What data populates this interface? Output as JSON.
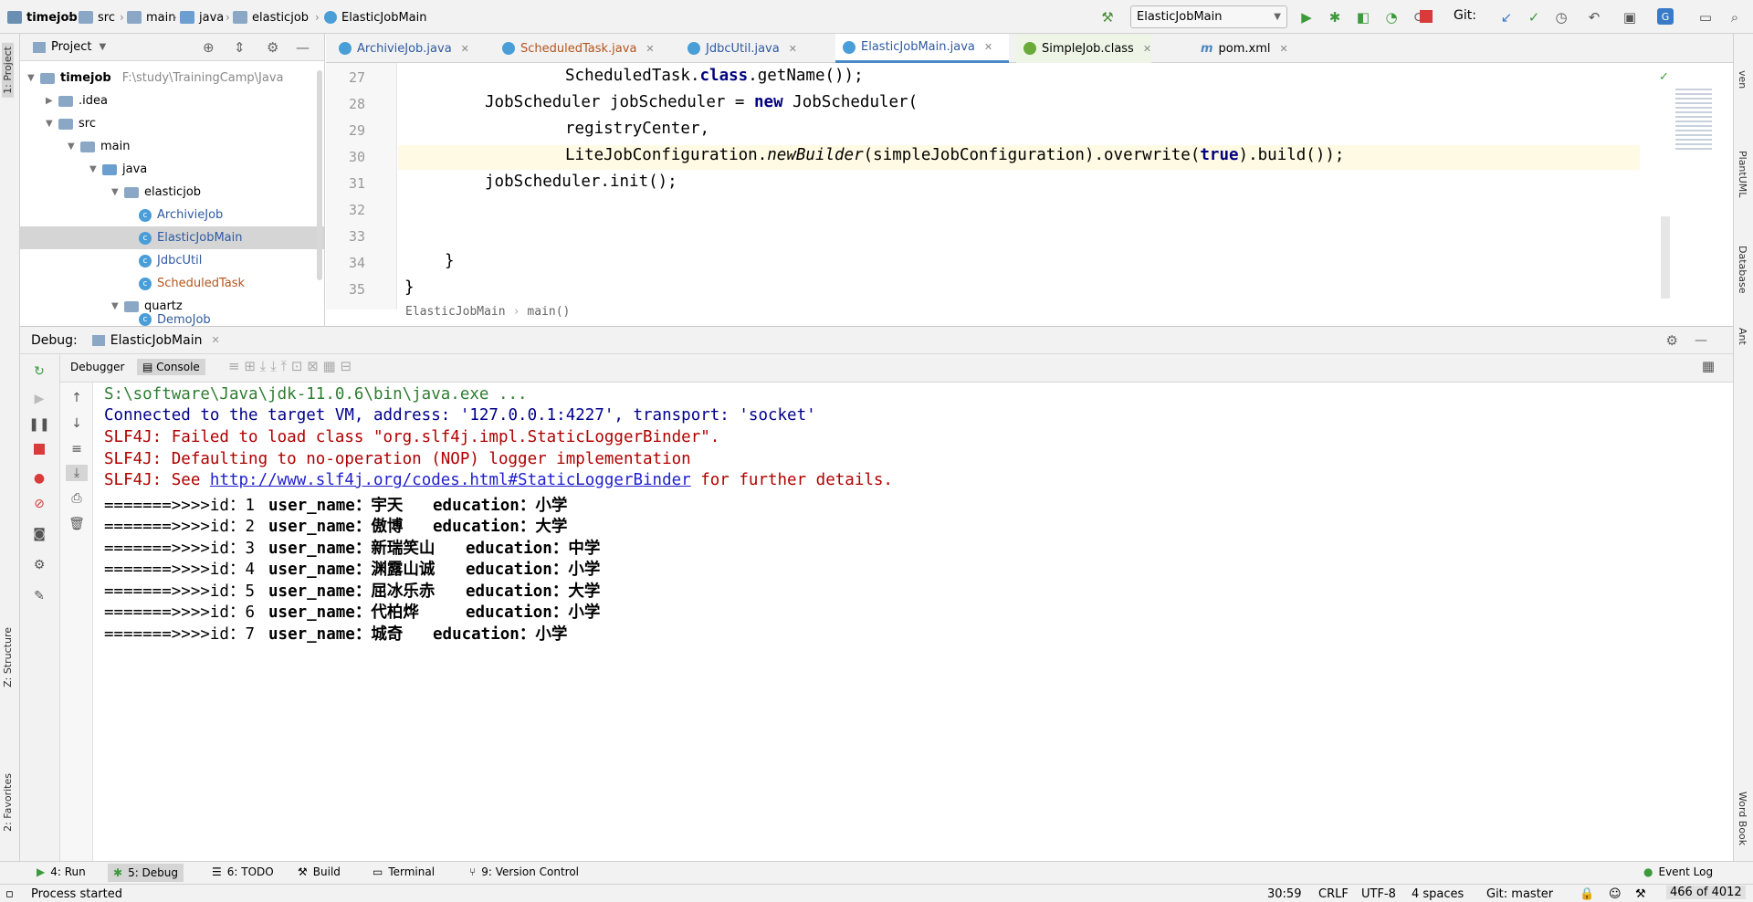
{
  "breadcrumbs": [
    "timejob",
    "src",
    "main",
    "java",
    "elasticjob",
    "ElasticJobMain"
  ],
  "run_config": "ElasticJobMain",
  "vcs_label": "Git:",
  "left_strip": {
    "project": "1: Project",
    "structure": "Z: Structure",
    "favorites": "2: Favorites"
  },
  "right_strip": {
    "maven": "ven",
    "plantuml": "PlantUML",
    "database": "Database",
    "ant": "Ant",
    "wordbook": "Word Book"
  },
  "project": {
    "title": "Project",
    "root": {
      "name": "timejob",
      "path": "F:\\study\\TrainingCamp\\Java"
    },
    "items": [
      ".idea",
      "src",
      "main",
      "java",
      "elasticjob",
      "ArchivieJob",
      "ElasticJobMain",
      "JdbcUtil",
      "ScheduledTask",
      "quartz"
    ],
    "partial_item": "DemoJob"
  },
  "tabs": [
    "ArchivieJob.java",
    "ScheduledTask.java",
    "JdbcUtil.java",
    "ElasticJobMain.java",
    "SimpleJob.class",
    "pom.xml"
  ],
  "active_tab": "ElasticJobMain.java",
  "editor": {
    "lines": [
      "27",
      "28",
      "29",
      "30",
      "31",
      "32",
      "33",
      "34",
      "35"
    ],
    "code": {
      "l27a": "ScheduledTask.",
      "l27kw": "class",
      "l27b": ".getName());",
      "l28a": "JobScheduler jobScheduler = ",
      "l28kw": "new",
      "l28b": " JobScheduler(",
      "l29": "registryCenter,",
      "l30a": "LiteJobConfiguration.",
      "l30it": "newBuilder",
      "l30b": "(simpleJobConfiguration).overwrite(",
      "l30kw": "true",
      "l30c": ").build());",
      "l31": "jobScheduler.init();",
      "l34": "}",
      "l35": "}"
    },
    "breadcrumb_class": "ElasticJobMain",
    "breadcrumb_method": "main()"
  },
  "debug": {
    "label": "Debug:",
    "session": "ElasticJobMain",
    "tab_debugger": "Debugger",
    "tab_console": "Console"
  },
  "console": {
    "cmd": "S:\\software\\Java\\jdk-11.0.6\\bin\\java.exe ...",
    "connected": "Connected to the target VM, address: '127.0.0.1:4227', transport: 'socket'",
    "slf1": "SLF4J: Failed to load class \"org.slf4j.impl.StaticLoggerBinder\".",
    "slf2": "SLF4J: Defaulting to no-operation (NOP) logger implementation",
    "slf3a": "SLF4J: See ",
    "slf3link": "http://www.slf4j.org/codes.html#StaticLoggerBinder",
    "slf3b": " for further details.",
    "rows": [
      {
        "id": "=======>>>>id：1",
        "name": "user_name：宇天",
        "edu": "education：小学"
      },
      {
        "id": "=======>>>>id：2",
        "name": "user_name：傲博",
        "edu": "education：大学"
      },
      {
        "id": "=======>>>>id：3",
        "name": "user_name：新瑞笑山",
        "edu": "education：中学"
      },
      {
        "id": "=======>>>>id：4",
        "name": "user_name：渊露山诚",
        "edu": "education：小学"
      },
      {
        "id": "=======>>>>id：5",
        "name": "user_name：屈冰乐赤",
        "edu": "education：大学"
      },
      {
        "id": "=======>>>>id：6",
        "name": "user_name：代柏烨",
        "edu": "education：小学"
      },
      {
        "id": "=======>>>>id：7",
        "name": "user_name：城奇",
        "edu": "education：小学"
      }
    ]
  },
  "bottom_tabs": {
    "run": "4: Run",
    "debug": "5: Debug",
    "todo": "6: TODO",
    "build": "Build",
    "terminal": "Terminal",
    "vcs": "9: Version Control",
    "eventlog": "Event Log"
  },
  "status": {
    "message": "Process started",
    "position": "30:59",
    "line_sep": "CRLF",
    "encoding": "UTF-8",
    "indent": "4 spaces",
    "branch": "Git: master",
    "memory": "466 of 4012"
  }
}
